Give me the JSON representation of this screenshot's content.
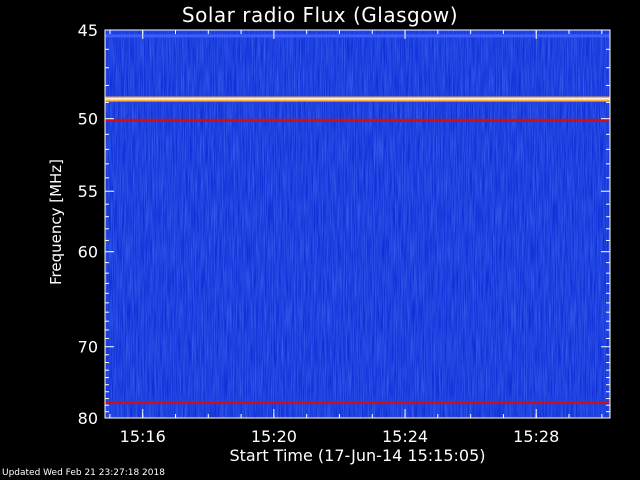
{
  "footer": {
    "updated": "Updated Wed Feb 21 23:27:18 2018"
  },
  "chart_data": {
    "type": "heatmap",
    "title": "Solar radio Flux (Glasgow)",
    "xlabel": "Start Time (17-Jun-14 15:15:05)",
    "ylabel": "Frequency [MHz]",
    "x_ticks": [
      "15:16",
      "15:20",
      "15:24",
      "15:28"
    ],
    "x_tick_minutes": [
      16,
      20,
      24,
      28
    ],
    "x_range_minutes": [
      14.85,
      30.25
    ],
    "y_ticks": [
      45,
      50,
      55,
      60,
      70,
      80
    ],
    "y_range_mhz": [
      45,
      80
    ],
    "y_scale": "reciprocal",
    "grid": false,
    "colormap": [
      "#000060",
      "#1030d8",
      "#3f5cff",
      "#d01010",
      "#ffb040",
      "#ffffff"
    ],
    "bands": [
      {
        "freq_mhz": 45.3,
        "level": 0.35
      },
      {
        "freq_mhz": 48.8,
        "level": 0.95
      },
      {
        "freq_mhz": 50.1,
        "level": 0.7
      },
      {
        "freq_mhz": 77.6,
        "level": 0.7
      }
    ]
  }
}
